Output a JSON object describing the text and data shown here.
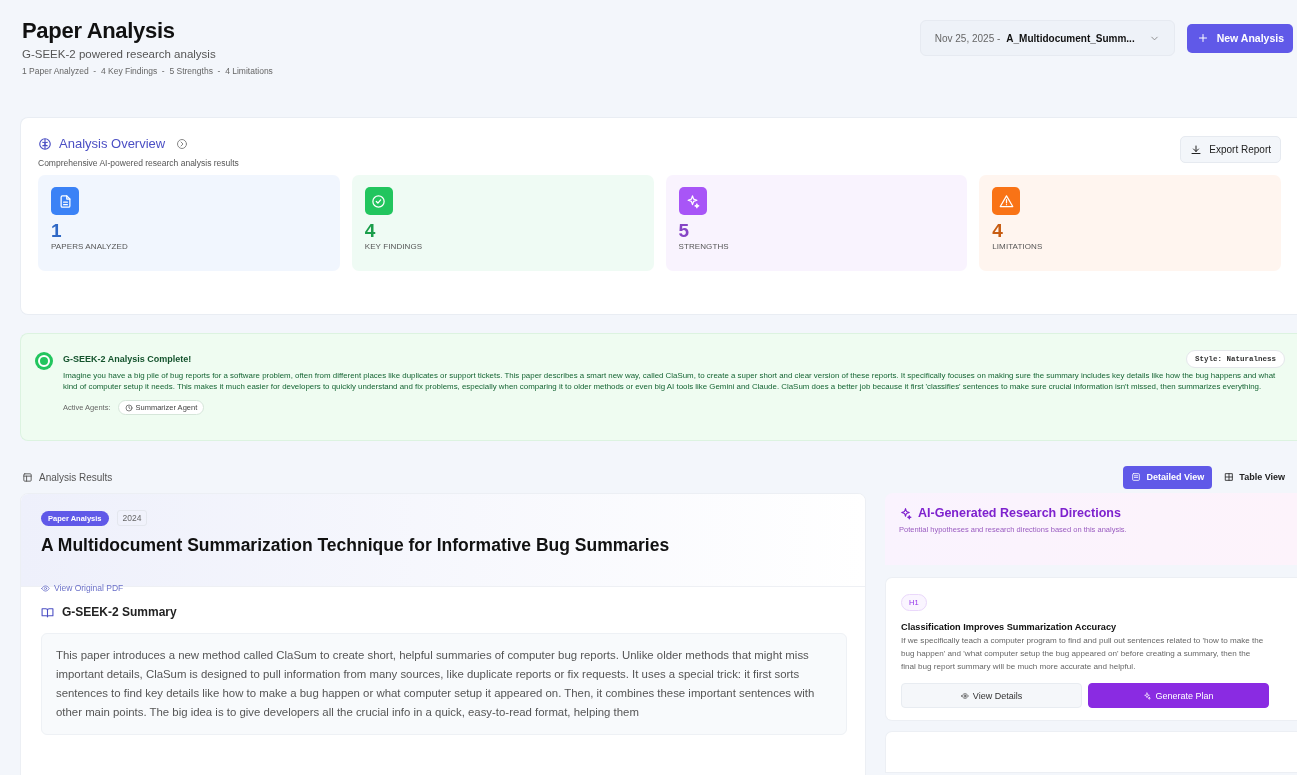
{
  "header": {
    "title": "Paper Analysis",
    "subtitle": "G-SEEK-2 powered research analysis",
    "meta": "1 Paper Analyzed  -  4 Key Findings  -  5 Strengths  -  4 Limitations",
    "selector": {
      "date": "Nov 25, 2025 -",
      "file": "A_Multidocument_Summ..."
    },
    "new_button": "New Analysis"
  },
  "overview": {
    "title": "Analysis Overview",
    "subtitle": "Comprehensive AI-powered research analysis results",
    "export_button": "Export Report",
    "stats": [
      {
        "kind": "document",
        "value": "1",
        "label": "PAPERS ANALYZED",
        "color": "#3b82f6"
      },
      {
        "kind": "check",
        "value": "4",
        "label": "KEY FINDINGS",
        "color": "#22c55e"
      },
      {
        "kind": "sparkle",
        "value": "5",
        "label": "STRENGTHS",
        "color": "#a855f7"
      },
      {
        "kind": "warning",
        "value": "4",
        "label": "LIMITATIONS",
        "color": "#f97316"
      }
    ]
  },
  "banner": {
    "title": "G-SEEK-2 Analysis Complete!",
    "style_badge": "Style: Naturalness",
    "text": "Imagine you have a big pile of bug reports for a software problem, often from different places like duplicates or support tickets. This paper describes a smart new way, called ClaSum, to create a super short and clear version of these reports. It specifically focuses on making sure the summary includes key details like how the bug happens and what kind of computer setup it needs. This makes it much easier for developers to quickly understand and fix problems, especially when comparing it to older methods or even big AI tools like Gemini and Claude. ClaSum does a better job because it first 'classifies' sentences to make sure crucial information isn't missed, then summarizes everything.",
    "agents_label": "Active Agents:",
    "agents": [
      "Summarizer Agent"
    ]
  },
  "results": {
    "title": "Analysis Results",
    "views": [
      {
        "label": "Detailed View",
        "selected": true
      },
      {
        "label": "Table View",
        "selected": false
      }
    ]
  },
  "paper": {
    "tag": "Paper Analysis",
    "year": "2024",
    "title": "A Multidocument Summarization Technique for Informative Bug Summaries",
    "pdf_link": "View Original PDF",
    "summary_title": "G-SEEK-2 Summary",
    "summary": "This paper introduces a new method called ClaSum to create short, helpful summaries of computer bug reports. Unlike older methods that might miss important details, ClaSum is designed to pull information from many sources, like duplicate reports or fix requests. It uses a special trick: it first sorts sentences to find key details like how to make a bug happen or what computer setup it appeared on. Then, it combines these important sentences with other main points. The big idea is to give developers all the crucial info in a quick, easy-to-read format, helping them"
  },
  "directions": {
    "title": "AI-Generated Research Directions",
    "subtitle": "Potential hypotheses and research directions based on this analysis.",
    "hypotheses": [
      {
        "badge": "H1",
        "title": "Classification Improves Summarization Accuracy",
        "text": "If we specifically teach a computer program to find and pull out sentences related to 'how to make the bug happen' and 'what computer setup the bug appeared on' before creating a summary, then the final bug report summary will be much more accurate and helpful.",
        "details_button": "View Details",
        "plan_button": "Generate Plan"
      }
    ]
  }
}
